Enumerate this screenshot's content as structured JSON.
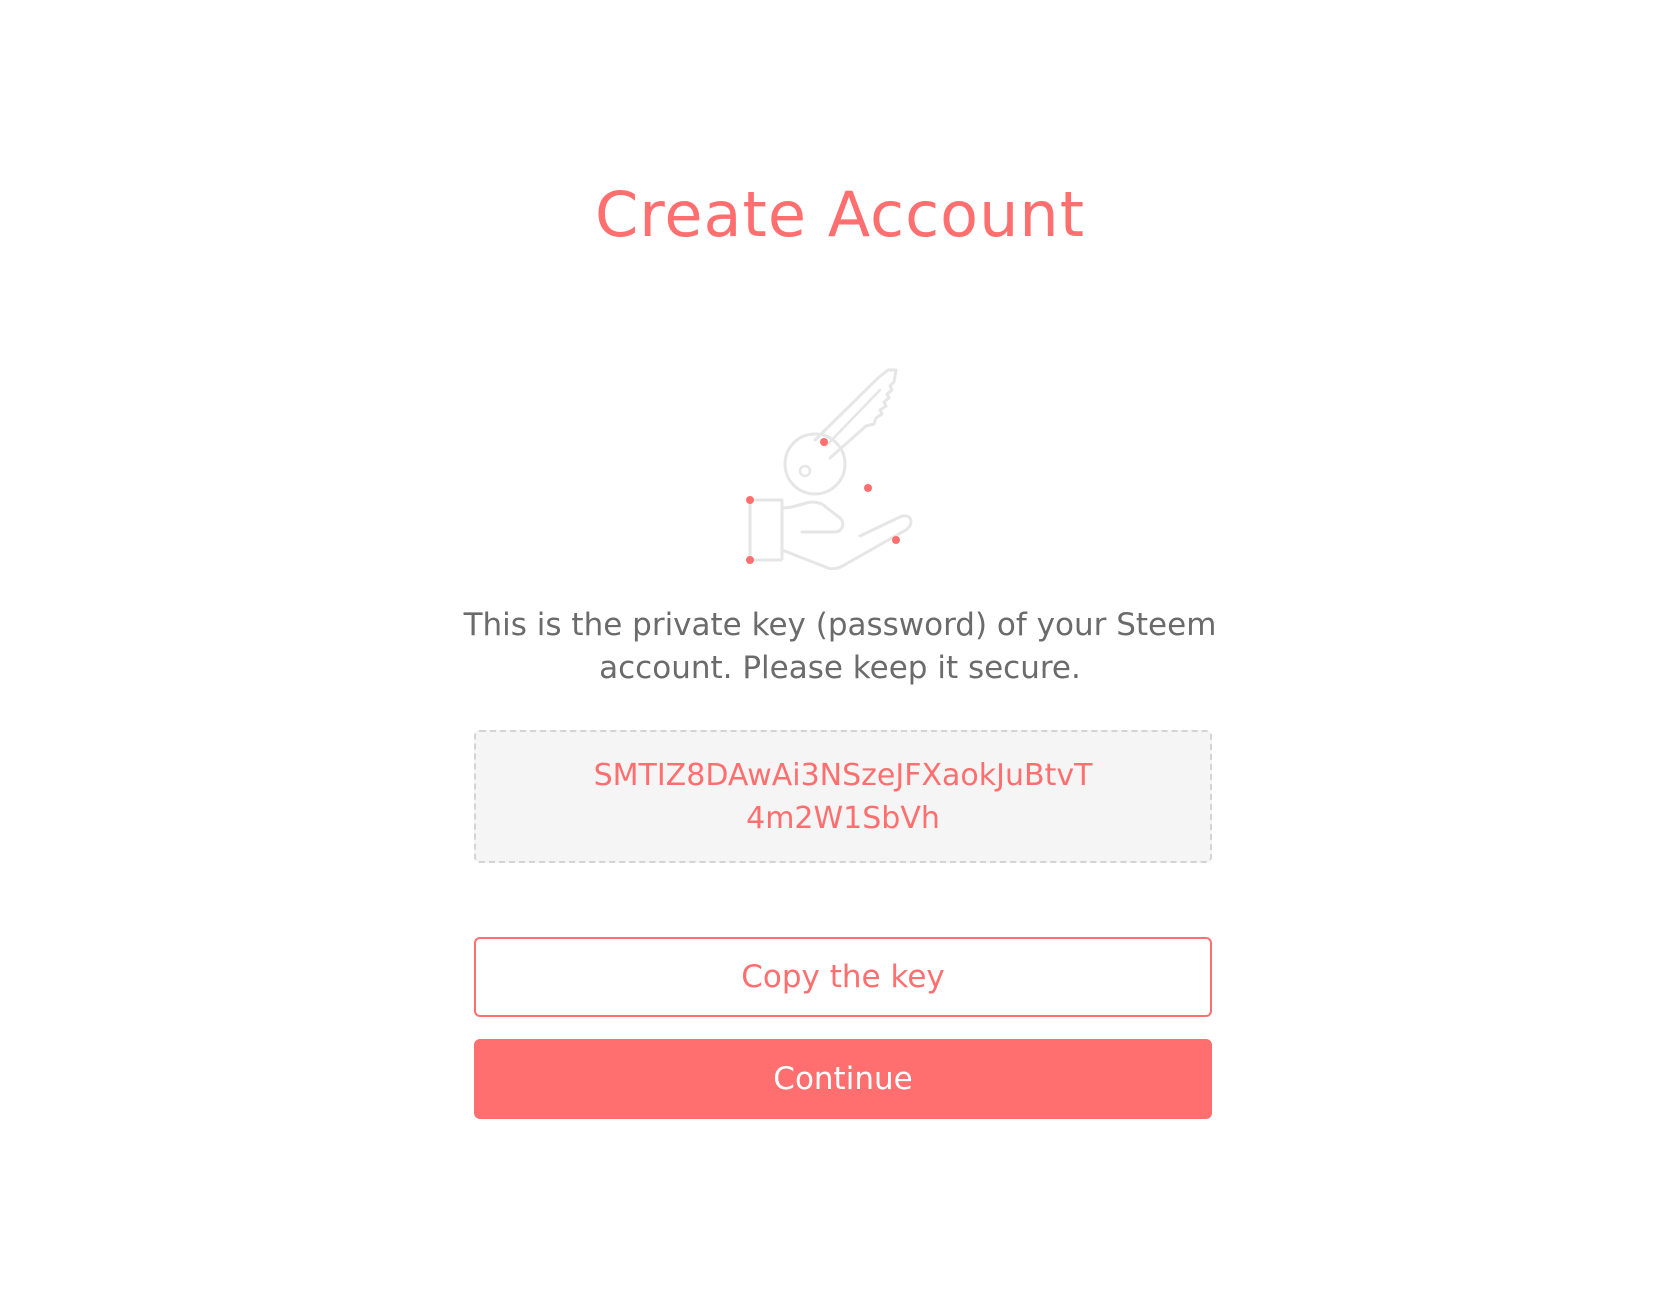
{
  "header": {
    "title": "Create Account"
  },
  "illustration": {
    "icon": "hand-holding-key-icon",
    "line_color": "#e6e6e6",
    "accent_color": "#ff6f6f"
  },
  "main": {
    "description": "This is the private key (password) of your Steem account. Please keep it secure.",
    "private_key": "SMTIZ8DAwAi3NSzeJFXaokJuBtvT4m2W1SbVh"
  },
  "actions": {
    "copy_label": "Copy the key",
    "continue_label": "Continue"
  },
  "colors": {
    "accent": "#ff6f6f",
    "text": "#6b6b6b",
    "key_box_bg": "#f5f5f5"
  }
}
